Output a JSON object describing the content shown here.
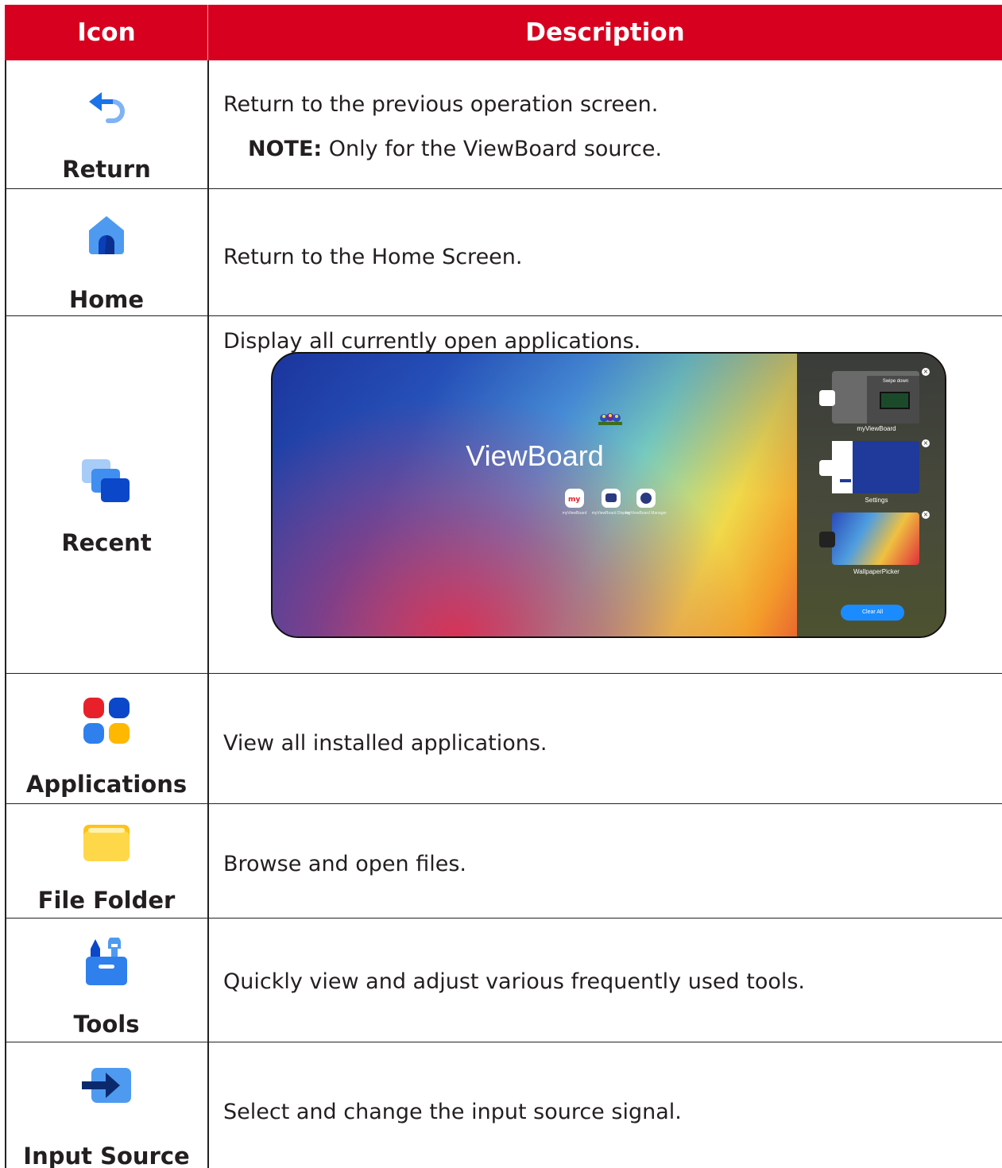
{
  "header": {
    "icon_col": "Icon",
    "description_col": "Description"
  },
  "rows": [
    {
      "label": "Return",
      "description": "Return to the previous operation screen.",
      "note_label": "NOTE:",
      "note_text": " Only for the ViewBoard source.",
      "icon": "return-arrow-icon"
    },
    {
      "label": "Home",
      "description": "Return to the Home Screen.",
      "icon": "home-icon"
    },
    {
      "label": "Recent",
      "description": "Display all currently open applications.",
      "icon": "recent-stack-icon"
    },
    {
      "label": "Applications",
      "description": "View all installed applications.",
      "icon": "applications-grid-icon"
    },
    {
      "label": "File Folder",
      "description": "Browse and open files.",
      "icon": "folder-icon"
    },
    {
      "label": "Tools",
      "description": "Quickly view and adjust various frequently used tools.",
      "icon": "toolbox-icon"
    },
    {
      "label": "Input Source",
      "description": "Select and change the input source signal.",
      "icon": "input-arrow-icon"
    }
  ],
  "screenshot": {
    "title": "ViewBoard",
    "apps": [
      "myViewBoard",
      "myViewBoard Display",
      "myViewBoard Manager"
    ],
    "recent_cards": [
      "myViewBoard",
      "Settings",
      "WallpaperPicker"
    ],
    "swipe_text": "Swipe down",
    "clear_all": "Clear All"
  },
  "colors": {
    "header_bg": "#d7001f",
    "icon_blue": "#1a73e8",
    "icon_red": "#e8202a",
    "icon_yellow": "#ffb800"
  }
}
